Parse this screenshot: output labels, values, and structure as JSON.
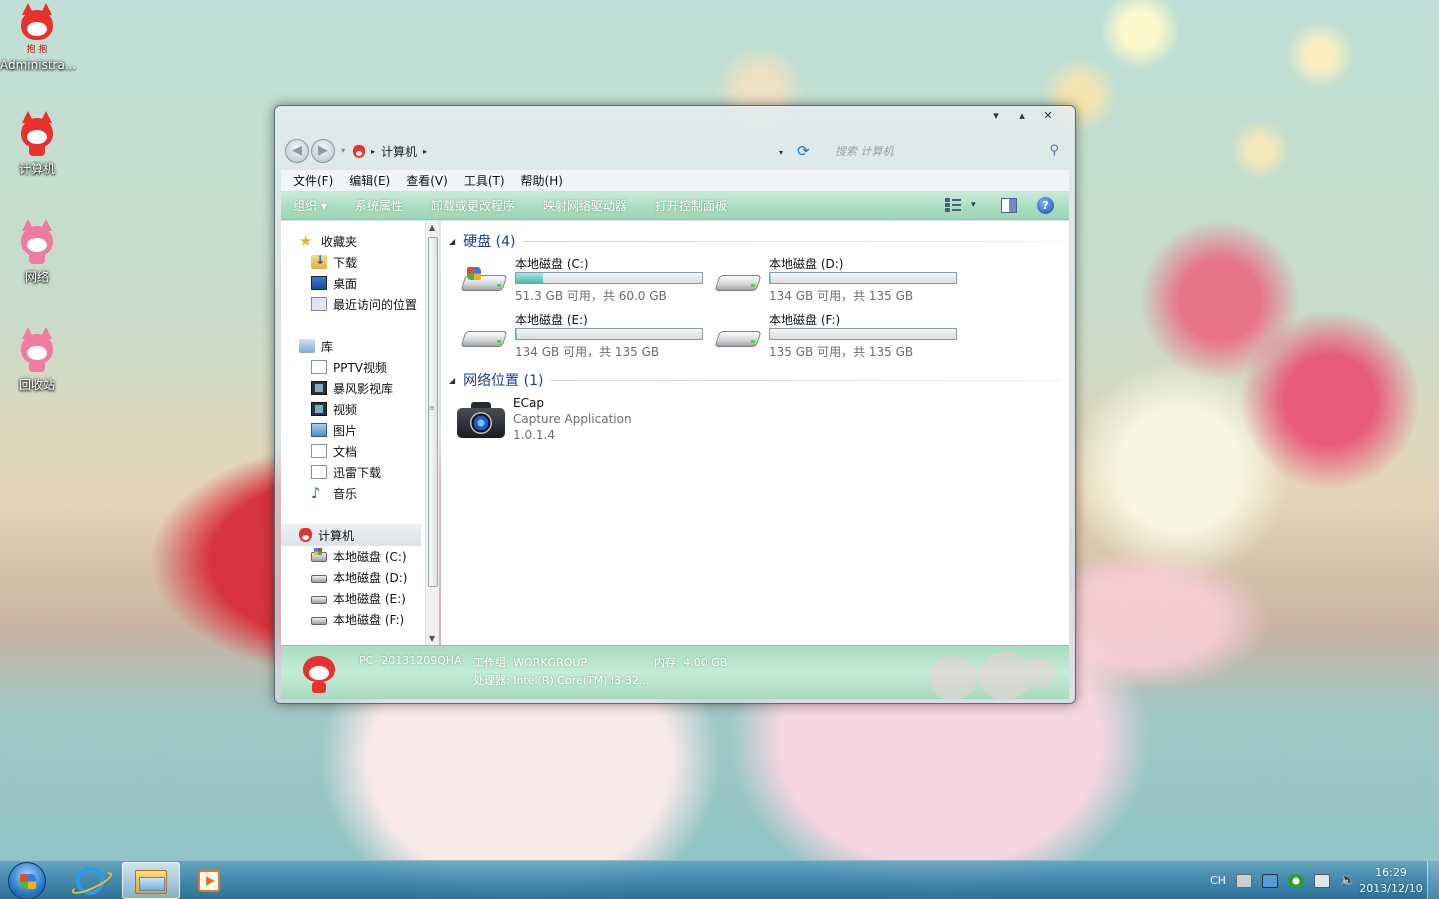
{
  "desktop": {
    "icons": [
      {
        "label": "Administra..."
      },
      {
        "label": "计算机"
      },
      {
        "label": "网络"
      },
      {
        "label": "回收站"
      }
    ],
    "admin_icon_text": "抱 抱"
  },
  "window": {
    "controls": {
      "minimize": "▾",
      "maximize": "▴",
      "close": "✕"
    },
    "nav": {
      "back": "◀",
      "forward": "▶",
      "history_dropdown": "▾"
    },
    "address": {
      "crumb": "计算机",
      "sep": "▸",
      "dropdown": "▾"
    },
    "search": {
      "placeholder": "搜索 计算机"
    },
    "menu": [
      "文件(F)",
      "编辑(E)",
      "查看(V)",
      "工具(T)",
      "帮助(H)"
    ],
    "commands": [
      "组织 ▾",
      "系统属性",
      "卸载或更改程序",
      "映射网络驱动器",
      "打开控制面板"
    ],
    "view_dropdown": "▾",
    "help": "?"
  },
  "navpane": {
    "favorites": {
      "label": "收藏夹",
      "items": [
        "下载",
        "桌面",
        "最近访问的位置"
      ]
    },
    "libraries": {
      "label": "库",
      "items": [
        "PPTV视频",
        "暴风影视库",
        "视频",
        "图片",
        "文档",
        "迅雷下载",
        "音乐"
      ]
    },
    "computer": {
      "label": "计算机",
      "items": [
        "本地磁盘 (C:)",
        "本地磁盘 (D:)",
        "本地磁盘 (E:)",
        "本地磁盘 (F:)"
      ]
    },
    "scroll": {
      "up": "▲",
      "down": "▼",
      "grip": "≡"
    }
  },
  "content": {
    "hdd_group": {
      "title": "硬盘 (4)",
      "toggle": "◢"
    },
    "drives": [
      {
        "name": "本地磁盘 (C:)",
        "free": "51.3 GB 可用，共 60.0 GB",
        "used_fraction": 0.145
      },
      {
        "name": "本地磁盘 (D:)",
        "free": "134 GB 可用，共 135 GB",
        "used_fraction": 0.0074
      },
      {
        "name": "本地磁盘 (E:)",
        "free": "134 GB 可用，共 135 GB",
        "used_fraction": 0.0074
      },
      {
        "name": "本地磁盘 (F:)",
        "free": "135 GB 可用，共 135 GB",
        "used_fraction": 0.0
      }
    ],
    "net_group": {
      "title": "网络位置 (1)",
      "toggle": "◢"
    },
    "network_item": {
      "name": "ECap",
      "desc": "Capture Application",
      "version": "1.0.1.4"
    }
  },
  "details": {
    "pc_name": "PC--20131209QHA",
    "workgroup": "工作组: WORKGROUP",
    "memory": "内存: 4.00 GB",
    "processor": "处理器: Intel(R) Core(TM) i3-32..."
  },
  "taskbar": {
    "tray_lang": "CH",
    "time": "16:29",
    "date": "2013/12/10"
  },
  "colors": {
    "command_bar": "#a8dcc0",
    "group_title": "#1e3b8a",
    "drive_fill": "#4fb8a6"
  }
}
